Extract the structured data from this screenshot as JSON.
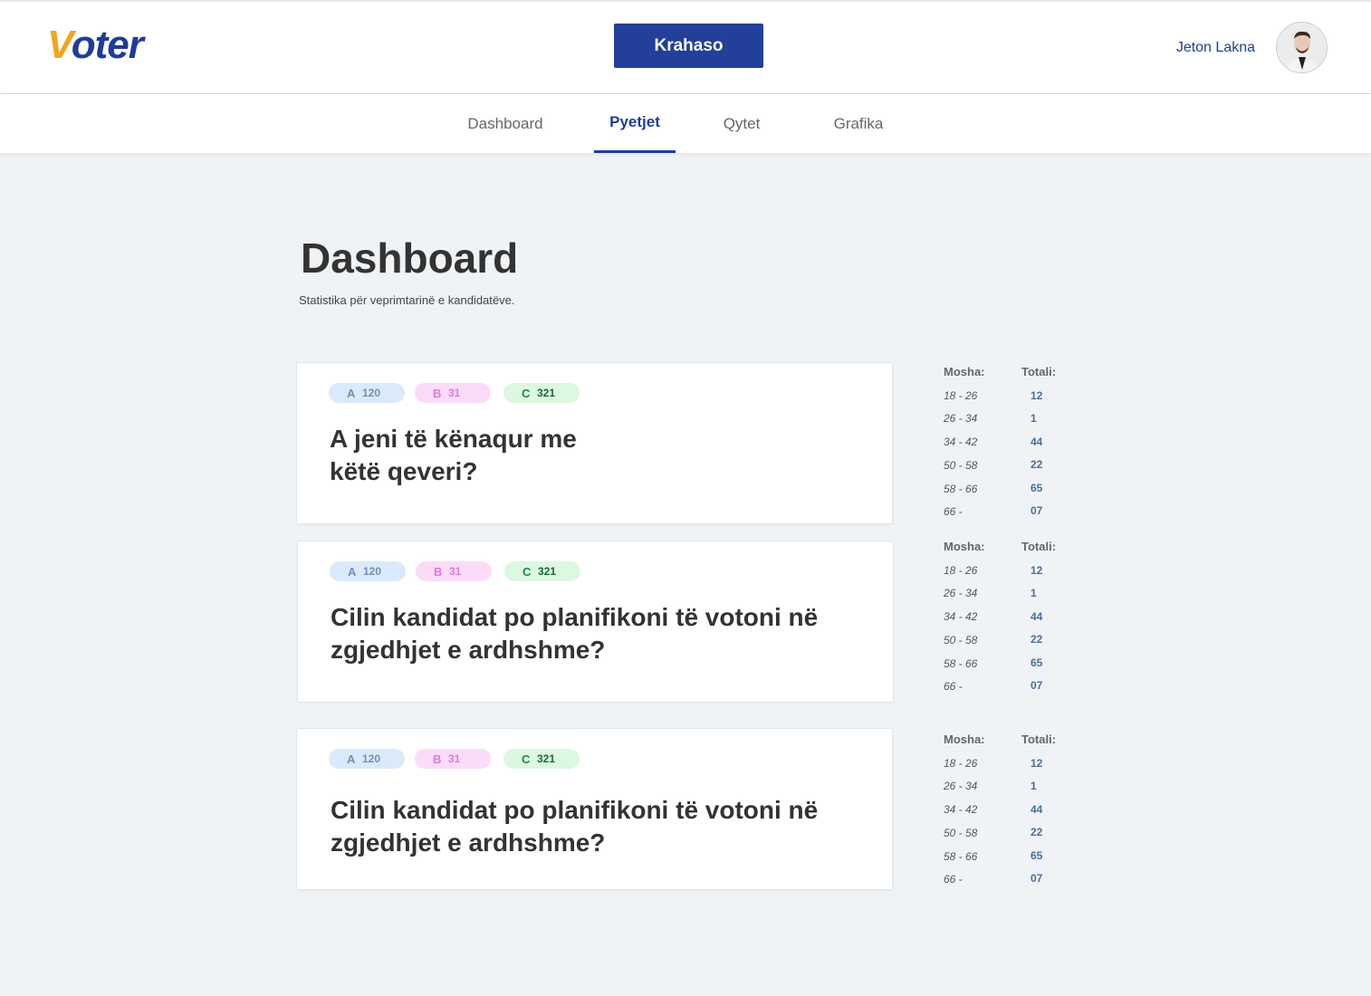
{
  "header": {
    "logo_v": "V",
    "logo_rest": "oter",
    "compare_label": "Krahaso",
    "user_name": "Jeton Lakna"
  },
  "nav": {
    "tabs": [
      {
        "label": "Dashboard",
        "active": false
      },
      {
        "label": "Pyetjet",
        "active": true
      },
      {
        "label": "Qytet",
        "active": false
      },
      {
        "label": "Grafika",
        "active": false
      }
    ]
  },
  "page": {
    "title": "Dashboard",
    "subtitle": "Statistika për veprimtarinë e kandidatëve."
  },
  "questions": [
    {
      "line1": "A jeni të kënaqur me",
      "line2": "këtë qeveri?",
      "badges": [
        {
          "letter": "A",
          "count": "120"
        },
        {
          "letter": "B",
          "count": "31"
        },
        {
          "letter": "C",
          "count": "321"
        }
      ]
    },
    {
      "line1": "Cilin kandidat po planifikoni të votoni në",
      "line2": "zgjedhjet e ardhshme?",
      "badges": [
        {
          "letter": "A",
          "count": "120"
        },
        {
          "letter": "B",
          "count": "31"
        },
        {
          "letter": "C",
          "count": "321"
        }
      ]
    },
    {
      "line1": "Cilin kandidat po planifikoni të votoni në",
      "line2": "zgjedhjet e ardhshme?",
      "badges": [
        {
          "letter": "A",
          "count": "120"
        },
        {
          "letter": "B",
          "count": "31"
        },
        {
          "letter": "C",
          "count": "321"
        }
      ]
    }
  ],
  "age_stats": {
    "age_header": "Mosha:",
    "total_header": "Totali:",
    "rows": [
      {
        "range": "18 - 26",
        "total": "12"
      },
      {
        "range": "26 - 34",
        "total": "1"
      },
      {
        "range": "34 - 42",
        "total": "44"
      },
      {
        "range": "50 - 58",
        "total": "22"
      },
      {
        "range": "58 - 66",
        "total": "65"
      },
      {
        "range": "66 -",
        "total": "07"
      }
    ]
  },
  "colors": {
    "brand": "#1f3c9a",
    "logo_accent": "#f2a51f",
    "badge_a": "#dbeafb",
    "badge_b": "#fbdcf8",
    "badge_c": "#ddf8e0",
    "background": "#eff3f6"
  },
  "icons": {
    "avatar": "user-avatar-photo"
  }
}
